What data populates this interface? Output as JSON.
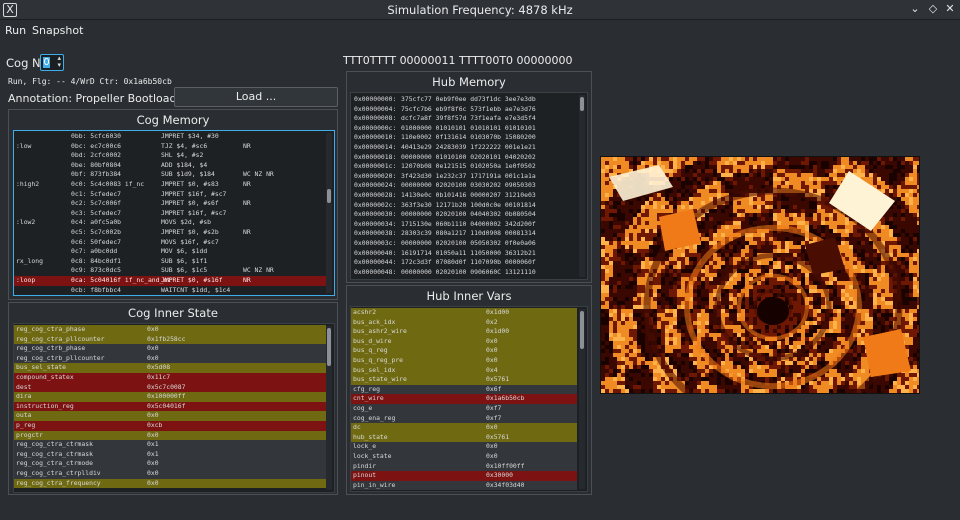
{
  "window": {
    "title": "Simulation Frequency: 4878 kHz",
    "icon": "x-app-icon",
    "min_glyph": "⌄",
    "restore_glyph": "◇",
    "close_glyph": "✕"
  },
  "menu": {
    "run": "Run",
    "snapshot": "Snapshot"
  },
  "cog": {
    "label": "Cog No",
    "value": "0",
    "status": "Run, Flg: -- 4/WrD Ctr: 0x1a6b50cb",
    "annotation": "Annotation: Propeller Bootloader",
    "load_label": "Load ..."
  },
  "pins": "TTT0TTTT 00000011 TTTT00T0 00000000",
  "cog_memory": {
    "title": "Cog Memory",
    "rows": [
      {
        "label": "",
        "addr": "0bb: 5cfc6030",
        "instr": "JMPRET $34, #30",
        "flags": ""
      },
      {
        "label": ":low",
        "addr": "0bc: ec7c00c6",
        "instr": "TJZ $4, #sc6",
        "flags": "NR"
      },
      {
        "label": "",
        "addr": "0bd: 2cfc0002",
        "instr": "SHL $4, #s2",
        "flags": ""
      },
      {
        "label": "",
        "addr": "0be: 80bf0804",
        "instr": "ADD $184, $4",
        "flags": ""
      },
      {
        "label": "",
        "addr": "0bf: 873fb384",
        "instr": "SUB $1d9, $184",
        "flags": "WC NZ NR"
      },
      {
        "label": ":high2",
        "addr": "0c0: 5c4c0083 if_nc",
        "instr": "JMPRET $0, #s83",
        "flags": "NR"
      },
      {
        "label": "",
        "addr": "0c1: 5cfedec7",
        "instr": "JMPRET $16f, #sc7",
        "flags": ""
      },
      {
        "label": "",
        "addr": "0c2: 5c7c006f",
        "instr": "JMPRET $0, #s6f",
        "flags": "NR"
      },
      {
        "label": "",
        "addr": "0c3: 5cfedec7",
        "instr": "JMPRET $16f, #sc7",
        "flags": ""
      },
      {
        "label": ":low2",
        "addr": "0c4: a0fc5a0b",
        "instr": "MOVS $2d, #sb",
        "flags": ""
      },
      {
        "label": "",
        "addr": "0c5: 5c7c002b",
        "instr": "JMPRET $0, #s2b",
        "flags": "NR"
      },
      {
        "label": "",
        "addr": "0c6: 50fedec7",
        "instr": "MOVS $16f, #sc7",
        "flags": ""
      },
      {
        "label": "",
        "addr": "0c7: a0bc0dd",
        "instr": "MOV $6, $1dd",
        "flags": ""
      },
      {
        "label": "rx_long",
        "addr": "0c8: 84bc0df1",
        "instr": "SUB $6, $1f1",
        "flags": ""
      },
      {
        "label": "",
        "addr": "0c9: 873c0dc5",
        "instr": "SUB $6, $1c5",
        "flags": "WC NZ NR"
      },
      {
        "label": ":loop",
        "addr": "0ca: 5c04016f if_nc_and_nz",
        "instr": "JMPRET $0, #s16f",
        "flags": "NR"
      },
      {
        "label": "",
        "addr": "0cb: f8bfbbc4",
        "instr": "WAITCNT $1dd, $1c4",
        "flags": ""
      }
    ]
  },
  "cog_inner": {
    "title": "Cog Inner State",
    "rows": [
      {
        "name": "reg_cog_ctra_phase",
        "value": "0x0",
        "kind": "olive"
      },
      {
        "name": "reg_cog_ctra_pllcounter",
        "value": "0x1fb258cc",
        "kind": "olive"
      },
      {
        "name": "reg_cog_ctrb_phase",
        "value": "0x0",
        "kind": "dark"
      },
      {
        "name": "reg_cog_ctrb_pllcounter",
        "value": "0x0",
        "kind": "dark"
      },
      {
        "name": "bus_sel_state",
        "value": "0x5d08",
        "kind": "olive"
      },
      {
        "name": "compound_statex",
        "value": "0x11c7",
        "kind": "red"
      },
      {
        "name": "dest",
        "value": "0x5c7c0087",
        "kind": "red"
      },
      {
        "name": "dira",
        "value": "0x100000ff",
        "kind": "olive"
      },
      {
        "name": "instruction_reg",
        "value": "0x5c04016f",
        "kind": "red"
      },
      {
        "name": "outa",
        "value": "0x0",
        "kind": "olive"
      },
      {
        "name": "p_reg",
        "value": "0xcb",
        "kind": "red"
      },
      {
        "name": "progctr",
        "value": "0x0",
        "kind": "olive"
      },
      {
        "name": "reg_cog_ctra_ctrmask",
        "value": "0x1",
        "kind": "dark"
      },
      {
        "name": "reg_cog_ctra_ctrmask",
        "value": "0x1",
        "kind": "dark"
      },
      {
        "name": "reg_cog_ctra_ctrmode",
        "value": "0x0",
        "kind": "dark"
      },
      {
        "name": "reg_cog_ctra_ctrplldiv",
        "value": "0x0",
        "kind": "dark"
      },
      {
        "name": "reg_cog_ctra_frequency",
        "value": "0x0",
        "kind": "olive"
      }
    ]
  },
  "hub_memory": {
    "title": "Hub Memory",
    "rows": [
      {
        "addr": "0x00000000:",
        "data": "375cfc77 0eb9f0ee dd73f1dc 3ee7e3db"
      },
      {
        "addr": "0x00000004:",
        "data": "75cfc7b6 eb9f8f6c 573f1ebb ae7e3d76"
      },
      {
        "addr": "0x00000008:",
        "data": "dcfc7a8f 39f8f57d 73f1eafa e7e3d5f4"
      },
      {
        "addr": "0x0000000c:",
        "data": "01000000 01010101 01010101 01010101"
      },
      {
        "addr": "0x00000010:",
        "data": "110e0002 0f131614 0103070b 15080200"
      },
      {
        "addr": "0x00000014:",
        "data": "40413e29 24283039 1f222222 001e1e21"
      },
      {
        "addr": "0x00000018:",
        "data": "00000000 01010100 02020101 04020202"
      },
      {
        "addr": "0x0000001c:",
        "data": "12070b08 0e121515 0102050a 1e0f0502"
      },
      {
        "addr": "0x00000020:",
        "data": "3f423d30 1e232c37 1717191a 001c1a1a"
      },
      {
        "addr": "0x00000024:",
        "data": "00000000 02020100 03030202 09050303"
      },
      {
        "addr": "0x00000028:",
        "data": "14130e0c 0b101416 00000207 31210e03"
      },
      {
        "addr": "0x0000002c:",
        "data": "363f3e30 12171b20 100d0c0e 00101814"
      },
      {
        "addr": "0x00000030:",
        "data": "00000000 02020100 04040302 0b080504"
      },
      {
        "addr": "0x00000034:",
        "data": "1715130e 060b1110 04000002 342d200f"
      },
      {
        "addr": "0x00000038:",
        "data": "28303c39 080a1217 110d0908 00081314"
      },
      {
        "addr": "0x0000003c:",
        "data": "00000000 02020100 05050302 0f0e0a06"
      },
      {
        "addr": "0x00000040:",
        "data": "16191714 01050a11 11050000 36312b21"
      },
      {
        "addr": "0x00000044:",
        "data": "172c3d3f 07080d0f 1107090b 0000060f"
      },
      {
        "addr": "0x00000048:",
        "data": "00000000 02020100 0906060C 13121110"
      }
    ]
  },
  "hub_inner": {
    "title": "Hub Inner Vars",
    "rows": [
      {
        "name": "acshr2",
        "value": "0x1d00",
        "kind": "olive"
      },
      {
        "name": "bus_ack_idx",
        "value": "0x2",
        "kind": "olive"
      },
      {
        "name": "bus_ashr2_wire",
        "value": "0x1d00",
        "kind": "olive"
      },
      {
        "name": "bus_d_wire",
        "value": "0x0",
        "kind": "olive"
      },
      {
        "name": "bus_q_reg",
        "value": "0x0",
        "kind": "olive"
      },
      {
        "name": "bus_q_reg_pre",
        "value": "0x0",
        "kind": "olive"
      },
      {
        "name": "bus_sel_idx",
        "value": "0x4",
        "kind": "olive"
      },
      {
        "name": "bus_state_wire",
        "value": "0x5761",
        "kind": "olive"
      },
      {
        "name": "cfg_reg",
        "value": "0x6f",
        "kind": "dark"
      },
      {
        "name": "cnt_wire",
        "value": "0x1a6b50cb",
        "kind": "red"
      },
      {
        "name": "cog_e",
        "value": "0xf7",
        "kind": "dark"
      },
      {
        "name": "cog_ena_reg",
        "value": "0xf7",
        "kind": "dark"
      },
      {
        "name": "dc",
        "value": "0x0",
        "kind": "olive"
      },
      {
        "name": "hub_state",
        "value": "0x5761",
        "kind": "olive"
      },
      {
        "name": "lock_e",
        "value": "0x0",
        "kind": "dark"
      },
      {
        "name": "lock_state",
        "value": "0x0",
        "kind": "dark"
      },
      {
        "name": "pindir",
        "value": "0x10ff00ff",
        "kind": "dark"
      },
      {
        "name": "pinout",
        "value": "0x30000",
        "kind": "red"
      },
      {
        "name": "pin_in_wire",
        "value": "0x34f03d40",
        "kind": "dark"
      }
    ]
  },
  "colors": {
    "olive": "#6f6a12",
    "red": "#7d1212",
    "dark": "#33373c",
    "list_bg": "#1e2124",
    "selection_border": "#3daee9",
    "viz_orange": "#f07a18",
    "viz_dark": "#4a0d02",
    "viz_light": "#fff3d6"
  }
}
